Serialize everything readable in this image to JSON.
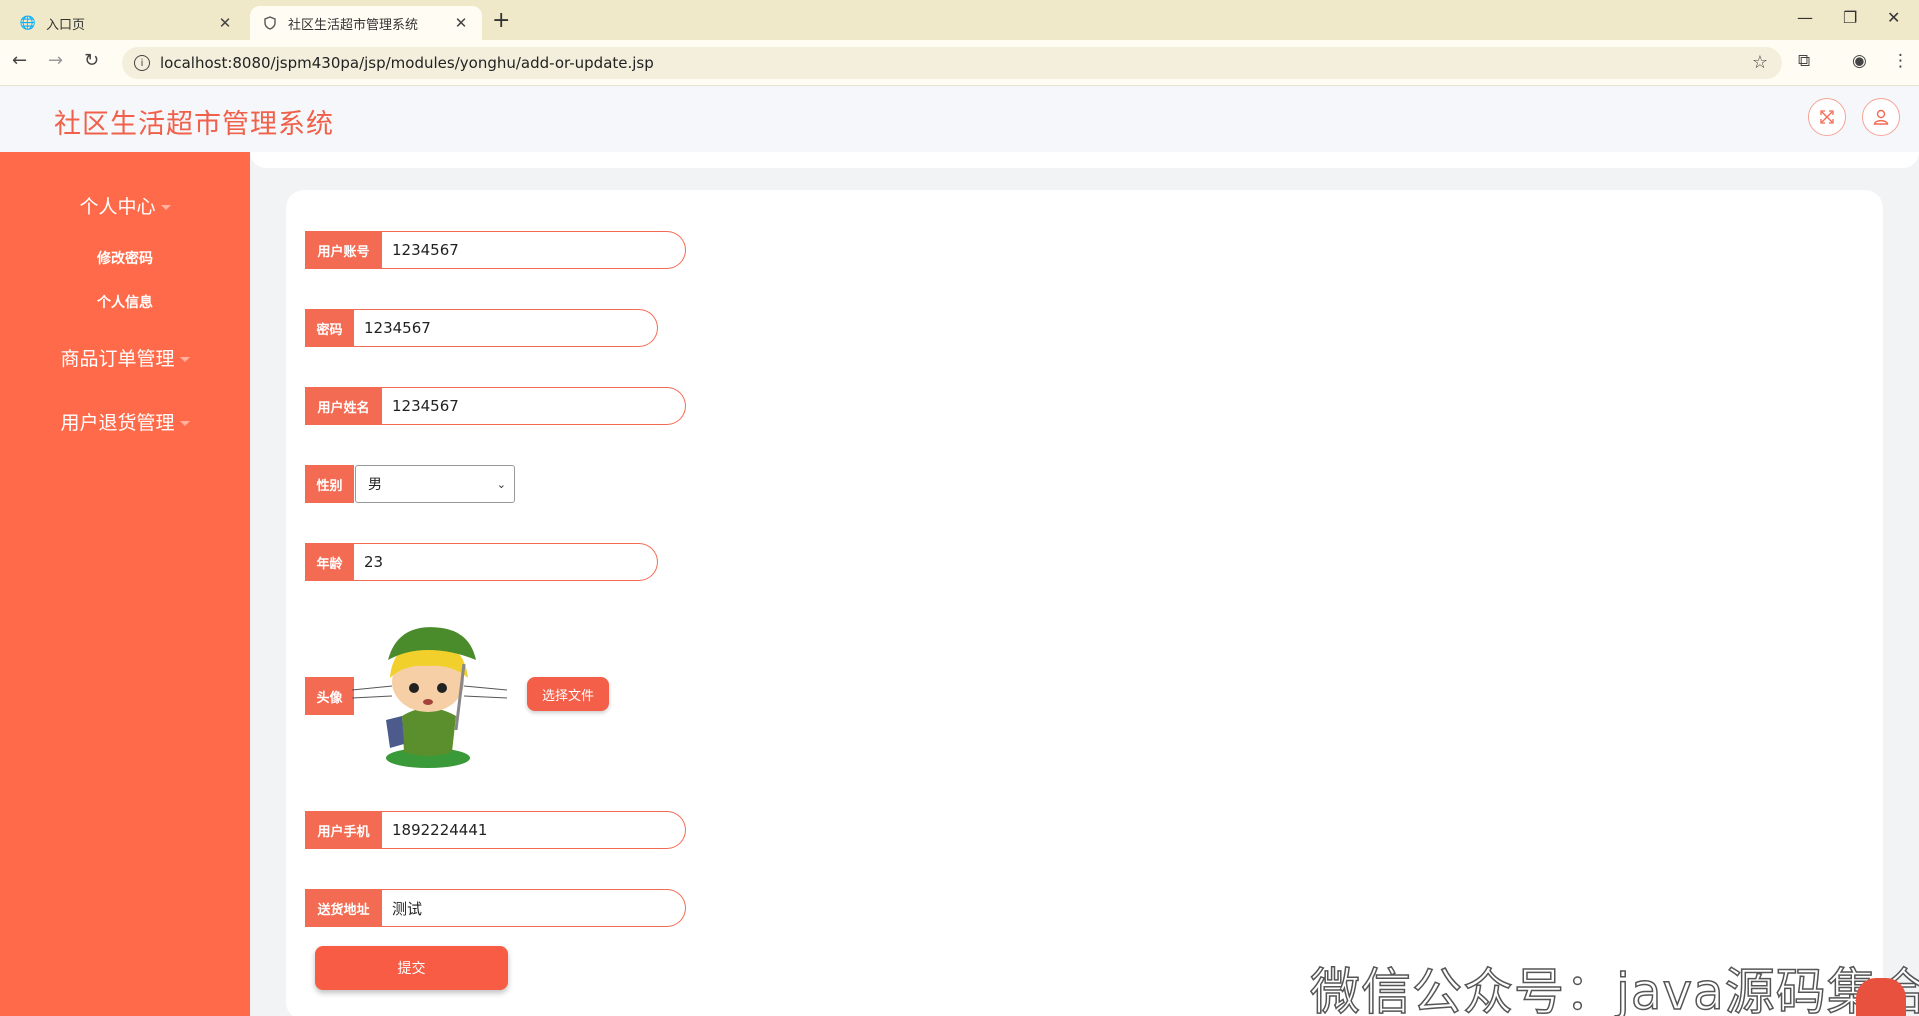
{
  "browser": {
    "tabs": [
      {
        "label": "入口页",
        "icon": "globe-icon"
      },
      {
        "label": "社区生活超市管理系统",
        "icon": "shield-icon"
      }
    ],
    "url": "localhost:8080/jspm430pa/jsp/modules/yonghu/add-or-update.jsp"
  },
  "app": {
    "title": "社区生活超市管理系统"
  },
  "sidebar": {
    "groups": [
      {
        "label": "个人中心",
        "items": [
          "修改密码",
          "个人信息"
        ]
      },
      {
        "label": "商品订单管理"
      },
      {
        "label": "用户退货管理"
      }
    ]
  },
  "form": {
    "account": {
      "label": "用户账号",
      "value": "1234567"
    },
    "password": {
      "label": "密码",
      "value": "1234567"
    },
    "name": {
      "label": "用户姓名",
      "value": "1234567"
    },
    "gender": {
      "label": "性别",
      "value": "男"
    },
    "age": {
      "label": "年龄",
      "value": "23"
    },
    "avatar": {
      "label": "头像",
      "button": "选择文件"
    },
    "phone": {
      "label": "用户手机",
      "value": "1892224441"
    },
    "address": {
      "label": "送货地址",
      "value": "测试"
    },
    "submit": "提交"
  },
  "watermark": "微信公众号：java源码集合",
  "colors": {
    "accent": "#ff6b4a",
    "title": "#f0604a",
    "chrome": "#efe9c9"
  }
}
